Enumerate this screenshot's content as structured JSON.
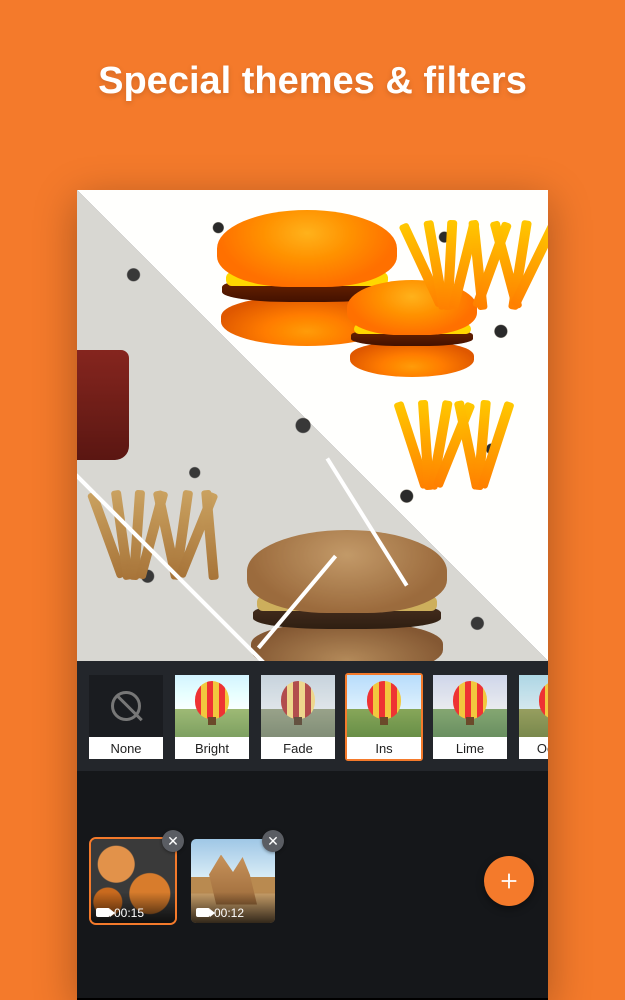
{
  "headline": "Special themes & filters",
  "filters": {
    "none": {
      "label": "None"
    },
    "bright": {
      "label": "Bright"
    },
    "fade": {
      "label": "Fade"
    },
    "ins": {
      "label": "Ins"
    },
    "lime": {
      "label": "Lime"
    },
    "ocean": {
      "label": "Ocean"
    }
  },
  "selected_filter": "ins",
  "clips": [
    {
      "duration": "00:15",
      "selected": true
    },
    {
      "duration": "00:12",
      "selected": false
    }
  ]
}
